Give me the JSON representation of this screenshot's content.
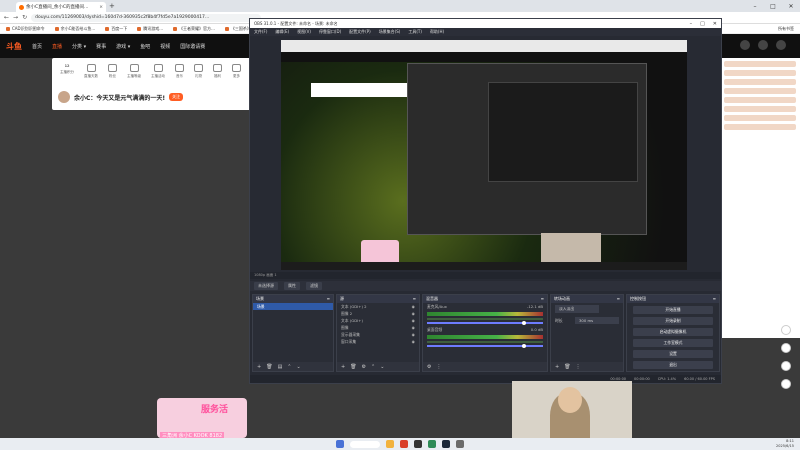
{
  "browser": {
    "tab_title": "余小C直播间_余小C的直播间...",
    "tab_close": "×",
    "newtab": "+",
    "url": "douyu.com/11269003/dyshid=160d7d-360935c2f8b4f7fd5e7a1929000417...",
    "bookmarks": [
      "CAD识别识图命令",
      "余小C能否给斗鱼...",
      "百度一下",
      "腾讯游戏...",
      "《王者荣耀》官方...",
      "《三国杀》",
      "斗鱼直播",
      "斗鱼"
    ],
    "bookmark_right": "所有书签"
  },
  "douyu": {
    "logo": "斗鱼",
    "nav": [
      "首页",
      "直播",
      "分类 ▾",
      "赛事",
      "游戏 ▾",
      "鱼吧",
      "视频",
      "国际邀请赛"
    ],
    "active_nav_index": 1,
    "quick_num": "12",
    "quick_items": [
      "主播积分",
      "直播天数",
      "粉丝",
      "主播等级",
      "主播活动",
      "音乐",
      "礼物",
      "福利",
      "更多"
    ],
    "title": "余小C：今天又是元气满满的一天!",
    "title_badge": "关注"
  },
  "obs": {
    "title": "OBS 31.0.1 - 配置文件: 未命名 - 场景: 未命名",
    "menu": [
      "文件(F)",
      "编辑(E)",
      "视图(V)",
      "停靠窗口(D)",
      "配置文件(P)",
      "场景集合(S)",
      "工具(T)",
      "帮助(H)"
    ],
    "status_top": "1080p  画面 1",
    "tabs": [
      "未选择源",
      "属性",
      "滤镜"
    ],
    "scenes_title": "场景",
    "scenes": [
      "场景"
    ],
    "sources_title": "源",
    "sources": [
      "文本 (GDI+) 2",
      "图像 2",
      "文本 (GDI+)",
      "图像",
      "显示器采集",
      "窗口采集"
    ],
    "mixer_title": "混音器",
    "mixer": [
      {
        "name": "麦克风/Aux",
        "db": "-12.1 dB"
      },
      {
        "name": "桌面音频",
        "db": "0.0 dB"
      }
    ],
    "transitions_title": "转场动画",
    "transition_type": "淡入淡出",
    "duration_label": "时长",
    "duration_value": "300 ms",
    "controls_title": "控制按钮",
    "controls": [
      "开始直播",
      "开始录制",
      "启动虚拟摄像机",
      "工作室模式",
      "设置",
      "退出"
    ],
    "status_bottom": [
      "00:00:00",
      "00:00:00",
      "CPU: 1.4%",
      "60.00 / 60.00 FPS"
    ]
  },
  "overlay": {
    "sticker_text": "服务活",
    "sticker_sub": "三角洲 余小C KOOK 8182"
  },
  "clock": {
    "time": "8:11",
    "date": "2025/6/15"
  }
}
